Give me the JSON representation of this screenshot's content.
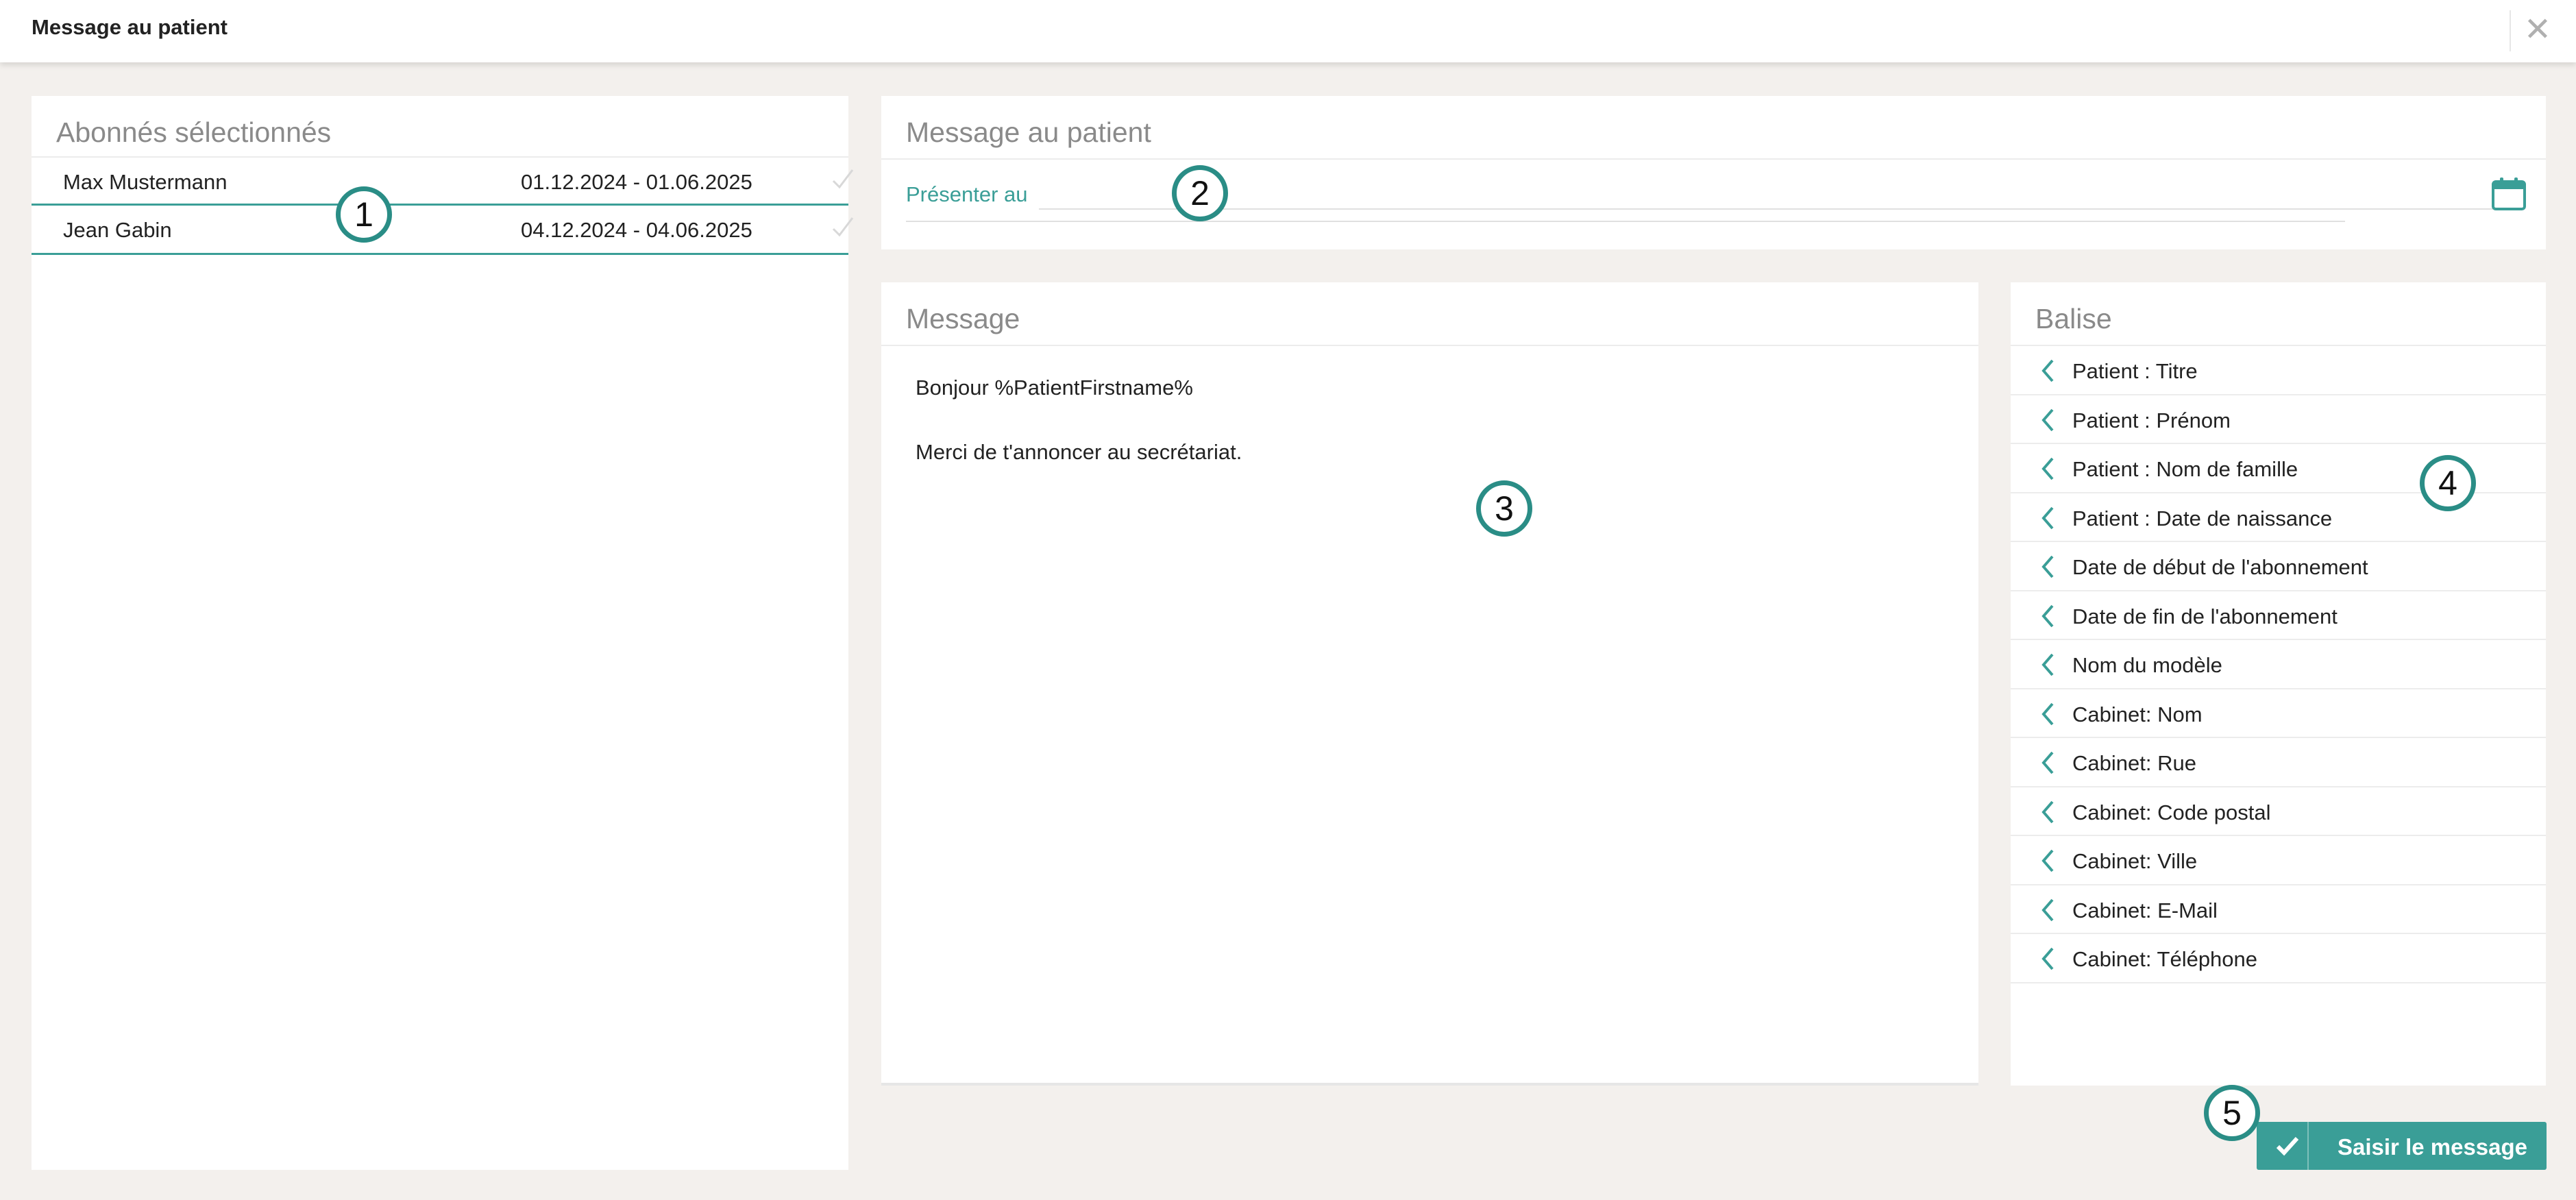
{
  "window": {
    "title": "Message au patient",
    "close_symbol": "✕"
  },
  "subscribers": {
    "title": "Abonnés sélectionnés",
    "rows": [
      {
        "name": "Max Mustermann",
        "dates": "01.12.2024 - 01.06.2025"
      },
      {
        "name": "Jean Gabin",
        "dates": "04.12.2024 - 04.06.2025"
      }
    ]
  },
  "present": {
    "title": "Message au patient",
    "label": "Présenter au",
    "value": ""
  },
  "message": {
    "title": "Message",
    "body": "Bonjour %PatientFirstname%\n\nMerci de t'annoncer au secrétariat."
  },
  "balise": {
    "title": "Balise",
    "items": [
      "Patient : Titre",
      "Patient : Prénom",
      "Patient : Nom de famille",
      "Patient : Date de naissance",
      "Date de début de l'abonnement",
      "Date de fin de l'abonnement",
      "Nom du modèle",
      "Cabinet: Nom",
      "Cabinet: Rue",
      "Cabinet: Code postal",
      "Cabinet: Ville",
      "Cabinet: E-Mail",
      "Cabinet: Téléphone"
    ]
  },
  "actions": {
    "submit_label": "Saisir le message"
  },
  "callouts": [
    "1",
    "2",
    "3",
    "4",
    "5"
  ],
  "colors": {
    "accent": "#3a9e97",
    "background": "#f3f0ed",
    "panel": "#ffffff"
  }
}
